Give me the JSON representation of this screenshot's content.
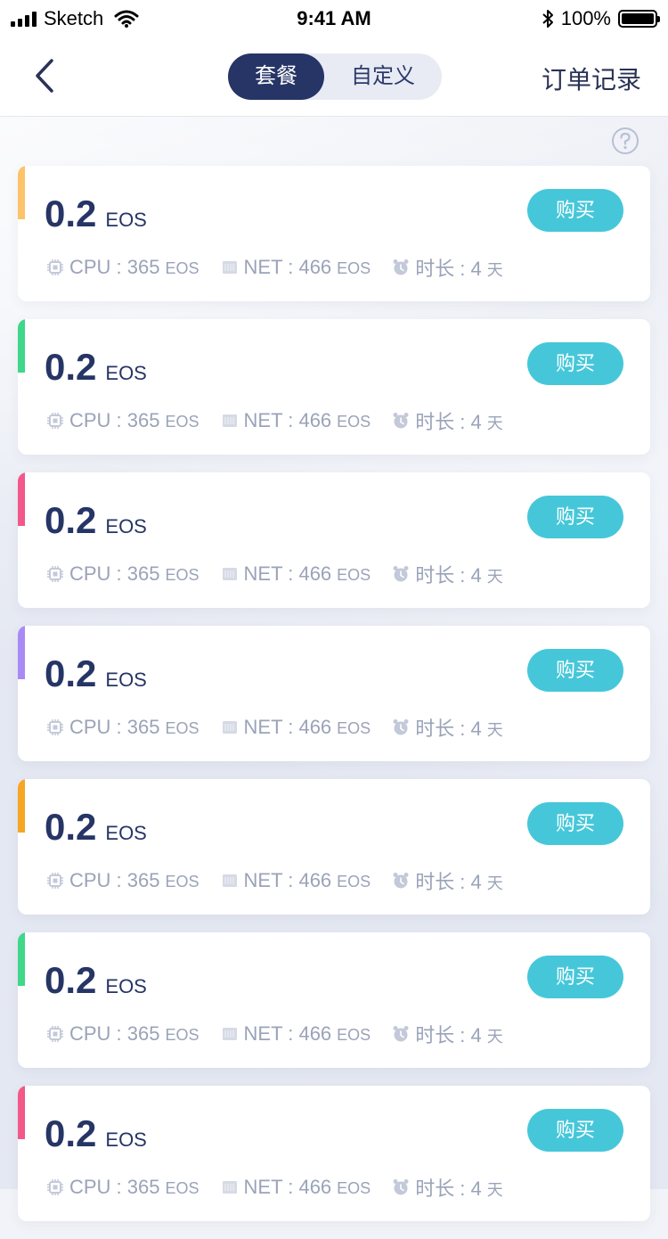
{
  "status_bar": {
    "carrier": "Sketch",
    "time": "9:41 AM",
    "battery_text": "100%",
    "battery_level": 1.0
  },
  "nav": {
    "tabs": [
      {
        "label": "套餐",
        "active": true
      },
      {
        "label": "自定义",
        "active": false
      }
    ],
    "orders_label": "订单记录"
  },
  "colors": {
    "brand_navy": "#263566",
    "buy_button": "#46c7d9",
    "meta_gray": "#9aa3b8"
  },
  "packages": [
    {
      "price": "0.2",
      "unit": "EOS",
      "accent": "#fcc36b",
      "cpu_label": "CPU : 365",
      "cpu_unit": "EOS",
      "net_label": "NET : 466",
      "net_unit": "EOS",
      "duration_label": "时长 : 4",
      "duration_unit": "天",
      "buy_label": "购买"
    },
    {
      "price": "0.2",
      "unit": "EOS",
      "accent": "#3fd78a",
      "cpu_label": "CPU : 365",
      "cpu_unit": "EOS",
      "net_label": "NET : 466",
      "net_unit": "EOS",
      "duration_label": "时长 : 4",
      "duration_unit": "天",
      "buy_label": "购买"
    },
    {
      "price": "0.2",
      "unit": "EOS",
      "accent": "#f2588a",
      "cpu_label": "CPU : 365",
      "cpu_unit": "EOS",
      "net_label": "NET : 466",
      "net_unit": "EOS",
      "duration_label": "时长 : 4",
      "duration_unit": "天",
      "buy_label": "购买"
    },
    {
      "price": "0.2",
      "unit": "EOS",
      "accent": "#a98af5",
      "cpu_label": "CPU : 365",
      "cpu_unit": "EOS",
      "net_label": "NET : 466",
      "net_unit": "EOS",
      "duration_label": "时长 : 4",
      "duration_unit": "天",
      "buy_label": "购买"
    },
    {
      "price": "0.2",
      "unit": "EOS",
      "accent": "#f5a623",
      "cpu_label": "CPU : 365",
      "cpu_unit": "EOS",
      "net_label": "NET : 466",
      "net_unit": "EOS",
      "duration_label": "时长 : 4",
      "duration_unit": "天",
      "buy_label": "购买"
    },
    {
      "price": "0.2",
      "unit": "EOS",
      "accent": "#3fd78a",
      "cpu_label": "CPU : 365",
      "cpu_unit": "EOS",
      "net_label": "NET : 466",
      "net_unit": "EOS",
      "duration_label": "时长 : 4",
      "duration_unit": "天",
      "buy_label": "购买"
    },
    {
      "price": "0.2",
      "unit": "EOS",
      "accent": "#f2588a",
      "cpu_label": "CPU : 365",
      "cpu_unit": "EOS",
      "net_label": "NET : 466",
      "net_unit": "EOS",
      "duration_label": "时长 : 4",
      "duration_unit": "天",
      "buy_label": "购买"
    }
  ]
}
